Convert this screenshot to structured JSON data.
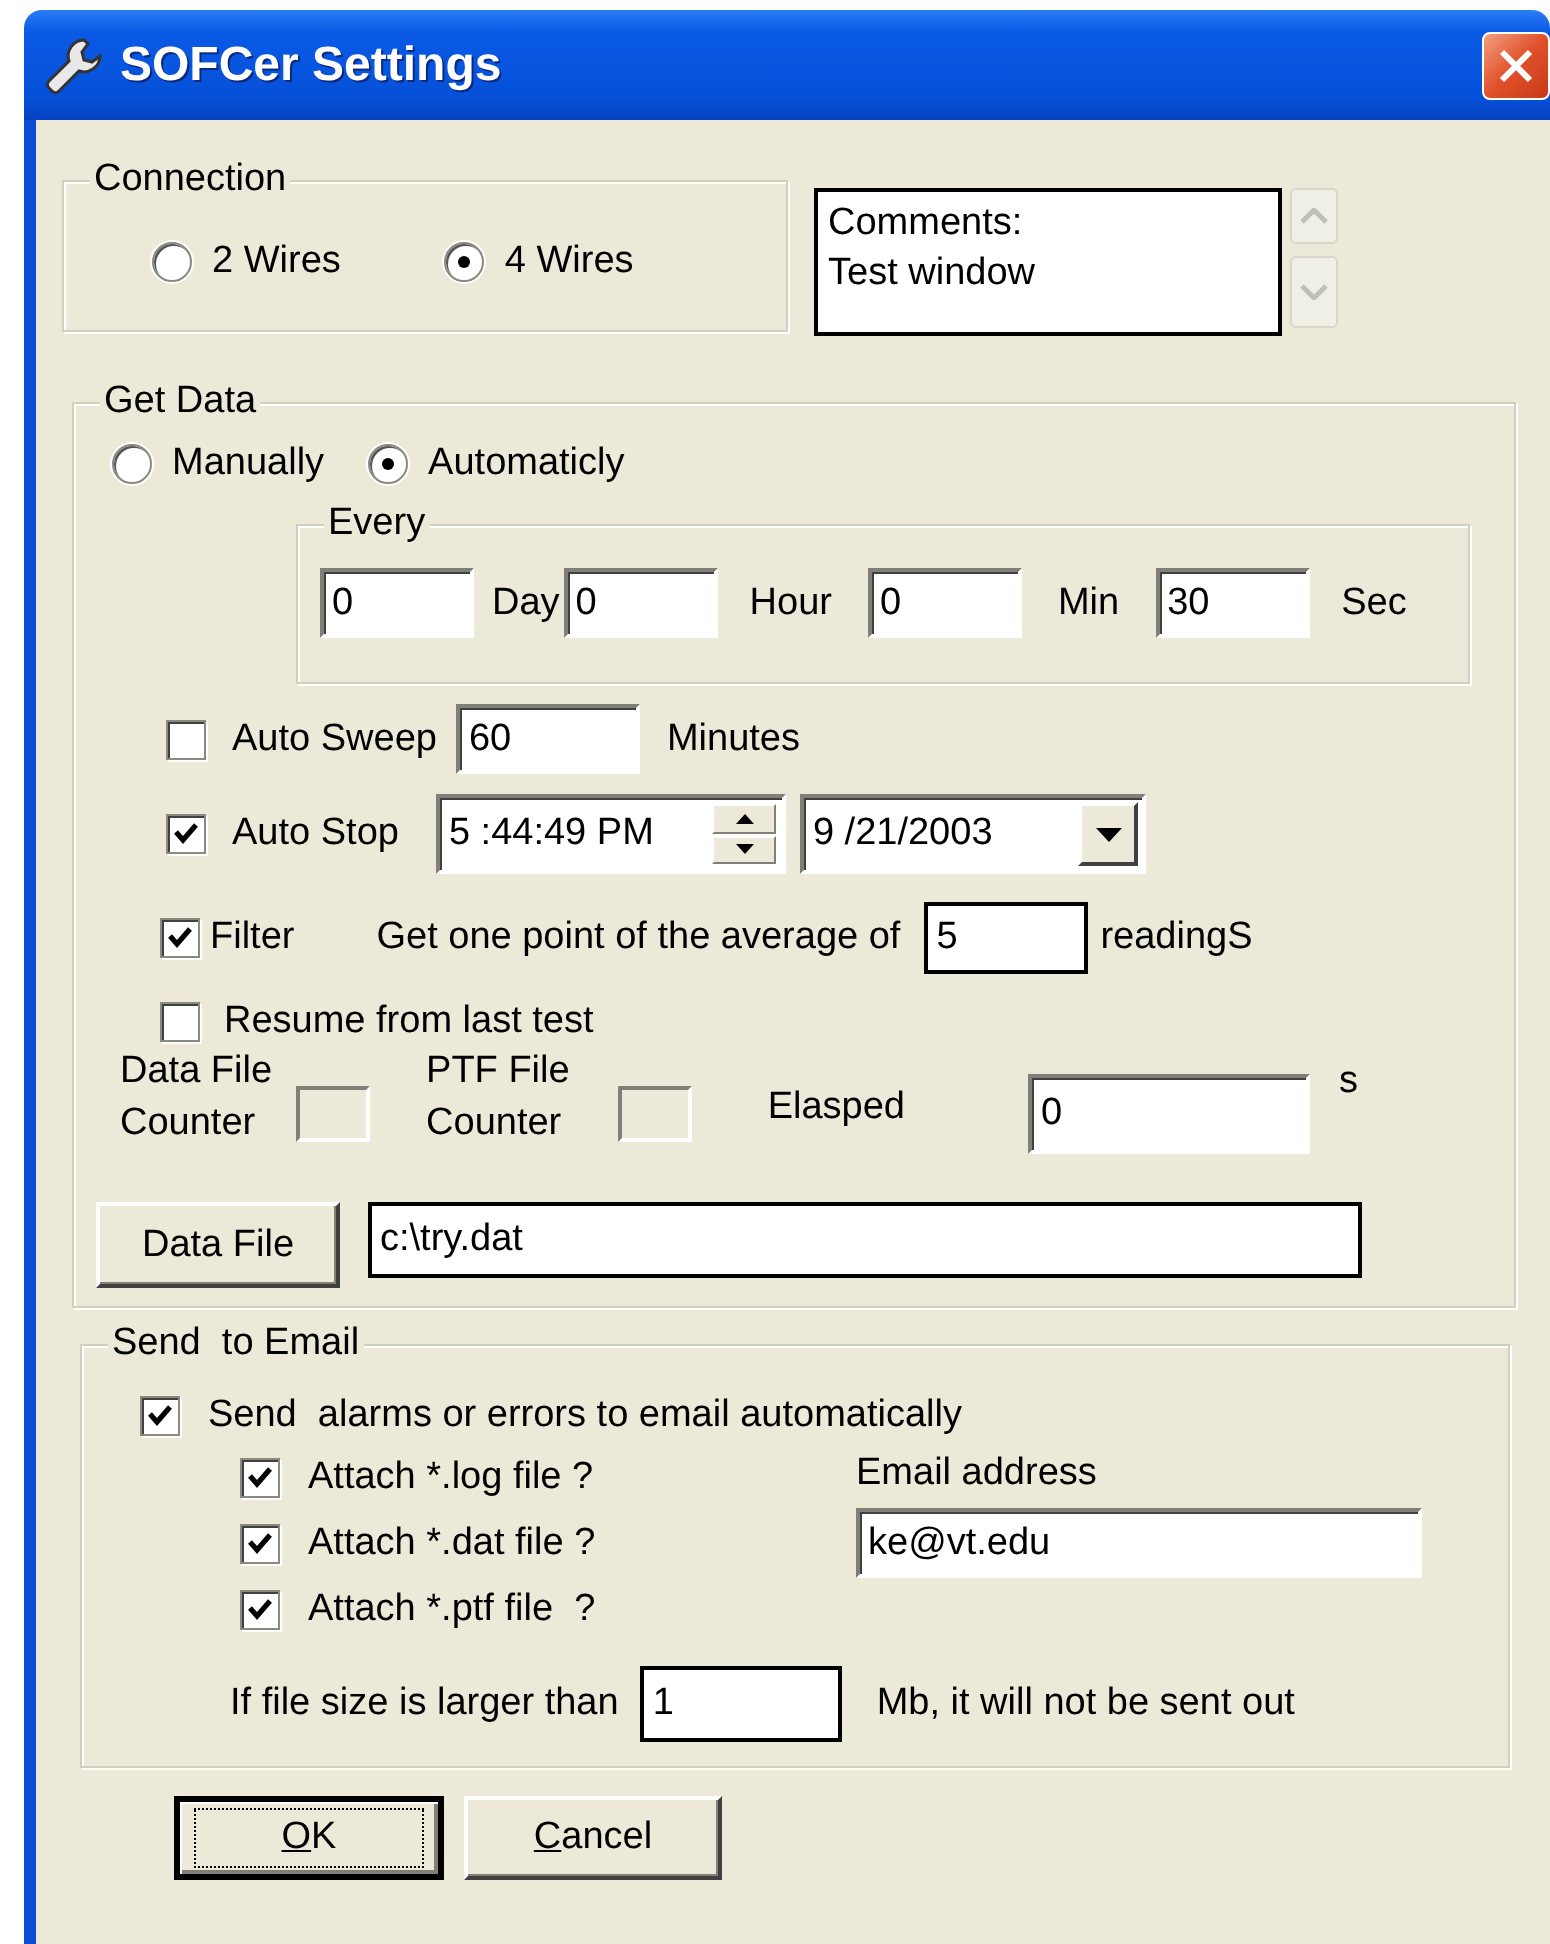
{
  "window": {
    "title": "SOFCer Settings"
  },
  "connection": {
    "label": "Connection",
    "options": [
      {
        "label": "2 Wires",
        "selected": false
      },
      {
        "label": "4 Wires",
        "selected": true
      }
    ]
  },
  "comments": {
    "value": "Comments:\nTest window"
  },
  "get_data": {
    "label": "Get Data",
    "modes": [
      {
        "label": "Manually",
        "selected": false
      },
      {
        "label": "Automaticly",
        "selected": true
      }
    ],
    "every": {
      "label": "Every",
      "fields": [
        {
          "value": "0",
          "unit": "Day"
        },
        {
          "value": "0",
          "unit": "Hour"
        },
        {
          "value": "0",
          "unit": "Min"
        },
        {
          "value": "30",
          "unit": "Sec"
        }
      ]
    },
    "auto_sweep": {
      "label": "Auto Sweep",
      "checked": false,
      "value": "60",
      "unit": "Minutes"
    },
    "auto_stop": {
      "label": "Auto Stop",
      "checked": true,
      "time": "5 :44:49 PM",
      "date": "9 /21/2003"
    },
    "filter": {
      "label": "Filter",
      "checked": true,
      "text": "Get one point of the average of",
      "value": "5",
      "unit": "readingS"
    },
    "resume": {
      "label": "Resume from last test",
      "checked": false
    },
    "counters": [
      {
        "label": "Data File\nCounter"
      },
      {
        "label": "PTF File\nCounter"
      }
    ],
    "elapsed": {
      "label": "Elasped",
      "value": "0",
      "unit": "s"
    },
    "data_file": {
      "button": "Data File",
      "value": "c:\\try.dat"
    }
  },
  "email": {
    "label": "Send  to Email",
    "send": {
      "label": "Send  alarms or errors to email automatically",
      "checked": true
    },
    "attachments": [
      {
        "label": "Attach *.log file ?",
        "checked": true
      },
      {
        "label": "Attach *.dat file ?",
        "checked": true
      },
      {
        "label": "Attach *.ptf file  ?",
        "checked": true
      }
    ],
    "address_label": "Email address",
    "address": "ke@vt.edu",
    "size_text": "If file size is larger than",
    "size_value": "1",
    "size_unit": "Mb, it will not be sent out"
  },
  "buttons": [
    {
      "label": "OK",
      "default": true
    },
    {
      "label": "Cancel",
      "default": false
    }
  ]
}
